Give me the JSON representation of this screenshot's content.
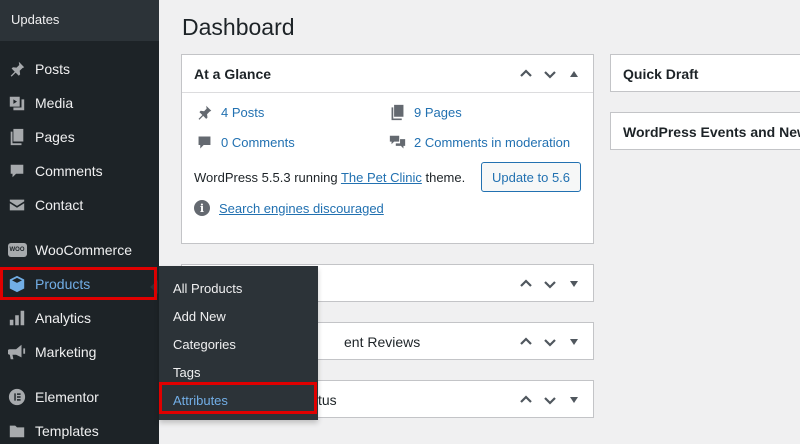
{
  "sidebar": {
    "updates_label": "Updates",
    "items": [
      {
        "label": "Posts",
        "icon": "pushpin-icon"
      },
      {
        "label": "Media",
        "icon": "media-icon"
      },
      {
        "label": "Pages",
        "icon": "pages-icon"
      },
      {
        "label": "Comments",
        "icon": "comments-icon"
      },
      {
        "label": "Contact",
        "icon": "envelope-icon"
      },
      {
        "label": "WooCommerce",
        "icon": "woocommerce-icon"
      },
      {
        "label": "Products",
        "icon": "box-icon"
      },
      {
        "label": "Analytics",
        "icon": "bar-chart-icon"
      },
      {
        "label": "Marketing",
        "icon": "megaphone-icon"
      },
      {
        "label": "Elementor",
        "icon": "elementor-icon"
      },
      {
        "label": "Templates",
        "icon": "folder-icon"
      }
    ],
    "woo_icon_text": "WOO"
  },
  "flyout": {
    "items": [
      "All Products",
      "Add New",
      "Categories",
      "Tags",
      "Attributes"
    ]
  },
  "main": {
    "title": "Dashboard",
    "glance": {
      "title": "At a Glance",
      "posts": "4 Posts",
      "pages": "9 Pages",
      "comments": "0 Comments",
      "moderation": "2 Comments in moderation",
      "wp_text_before": "WordPress 5.5.3 running ",
      "theme_name": "The Pet Clinic",
      "wp_text_after": " theme.",
      "update_button": "Update to 5.6",
      "seo_text": "Search engines discouraged",
      "info_glyph": "i"
    },
    "box2_title": "",
    "box3_title": "ent Reviews",
    "box4_title": "tus",
    "quick_draft": "Quick Draft",
    "events": "WordPress Events and News"
  },
  "colors": {
    "sidebar_bg": "#1d2327",
    "accent": "#72aee6",
    "link": "#2271b1",
    "highlight": "#e00000"
  }
}
